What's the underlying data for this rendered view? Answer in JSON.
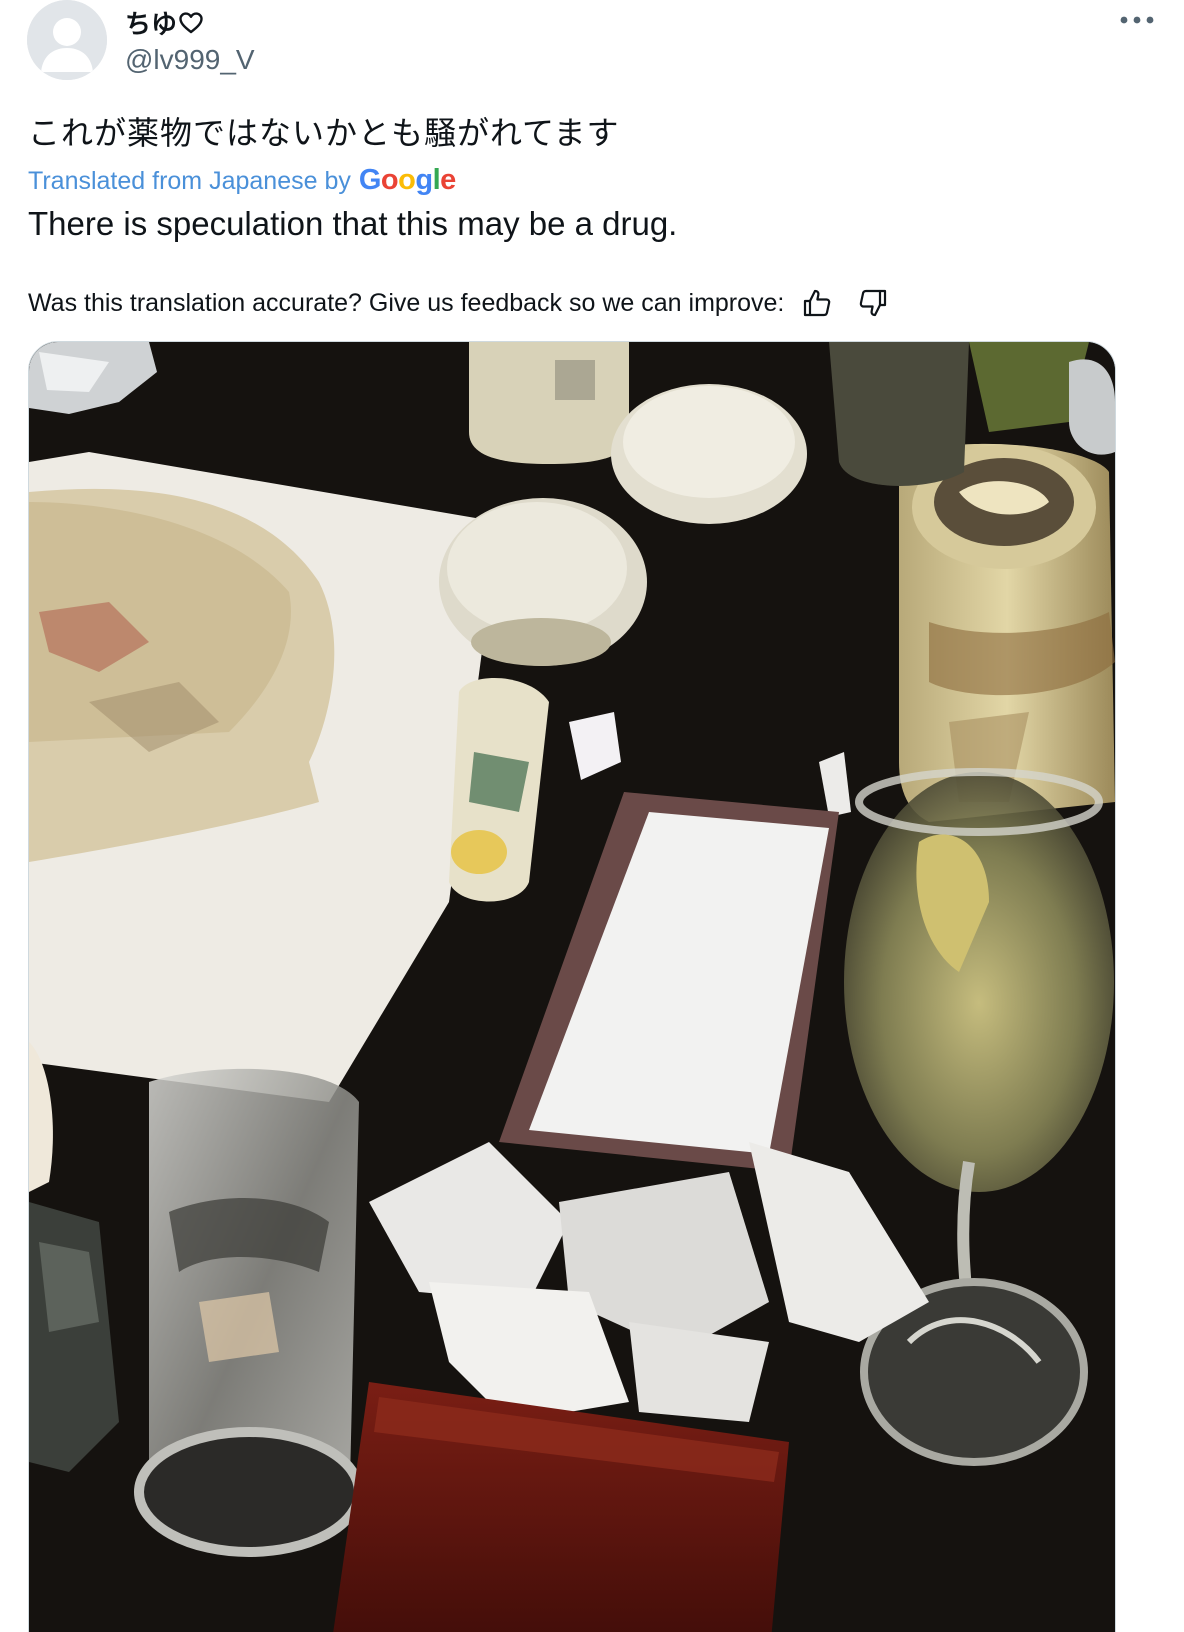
{
  "author": {
    "display_name": "ちゆ",
    "handle": "@lv999_V"
  },
  "tweet": {
    "text": "これが薬物ではないかとも騒がれてます",
    "translated_from": "Translated from Japanese by",
    "translator_logo": [
      "G",
      "o",
      "o",
      "g",
      "l",
      "e"
    ],
    "translation": "There is speculation that this may be a drug.",
    "feedback_prompt": "Was this translation accurate? Give us feedback so we can improve:"
  },
  "icons": {
    "more": "more-dots-icon",
    "heart": "heart-outline-icon",
    "thumbs_up": "thumbs-up-icon",
    "thumbs_down": "thumbs-down-icon",
    "avatar": "default-avatar-icon"
  },
  "colors": {
    "link_blue": "#1d9bf0",
    "text_primary": "#0f1419",
    "text_secondary": "#536471",
    "google_blue": "#4285f4",
    "google_red": "#ea4335",
    "google_yellow": "#fbbc05",
    "google_green": "#34a853"
  }
}
